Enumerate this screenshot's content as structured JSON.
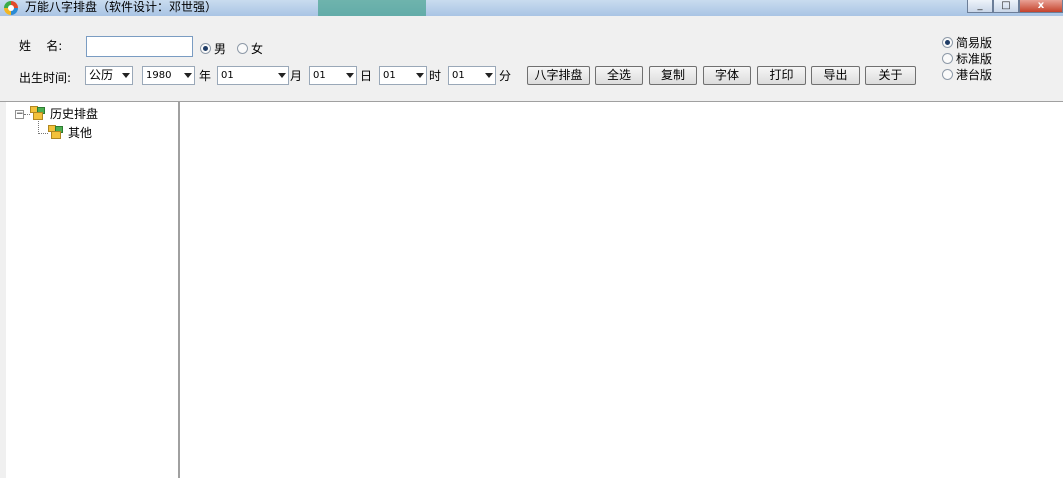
{
  "window": {
    "title": "万能八字排盘（软件设计：邓世强）",
    "close_label": "x",
    "minimize_label": "_",
    "maximize_label": "□"
  },
  "form": {
    "name_label": "姓    名:",
    "name_value": "",
    "gender": {
      "male_label": "男",
      "female_label": "女",
      "selected": "男"
    },
    "birth_label": "出生时间:",
    "calendar_value": "公历",
    "year_value": "1980",
    "year_unit": "年",
    "month_value": "01",
    "month_unit": "月",
    "day_value": "01",
    "day_unit": "日",
    "hour_value": "01",
    "hour_unit": "时",
    "minute_value": "01",
    "minute_unit": "分"
  },
  "toolbar": {
    "bazi_label": "八字排盘",
    "select_all_label": "全选",
    "copy_label": "复制",
    "font_label": "字体",
    "print_label": "打印",
    "export_label": "导出",
    "about_label": "关于"
  },
  "versions": {
    "items": [
      "简易版",
      "标准版",
      "港台版"
    ],
    "selected": "简易版"
  },
  "tree": {
    "root_label": "历史排盘",
    "child_label": "其他",
    "expander": "−"
  }
}
